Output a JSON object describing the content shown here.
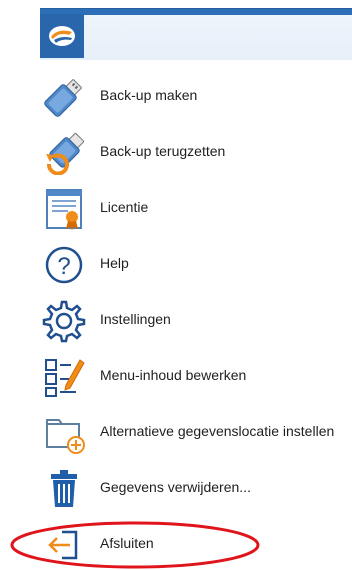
{
  "app": {
    "title_button": "app-logo"
  },
  "menu": {
    "items": [
      {
        "label": "Back-up maken",
        "icon": "usb-drive-icon"
      },
      {
        "label": "Back-up terugzetten",
        "icon": "usb-restore-icon"
      },
      {
        "label": "Licentie",
        "icon": "certificate-icon"
      },
      {
        "label": "Help",
        "icon": "help-icon"
      },
      {
        "label": "Instellingen",
        "icon": "gear-icon"
      },
      {
        "label": "Menu-inhoud bewerken",
        "icon": "edit-list-icon"
      },
      {
        "label": "Alternatieve gegevenslocatie instellen",
        "icon": "folder-add-icon"
      },
      {
        "label": "Gegevens verwijderen...",
        "icon": "trash-icon"
      },
      {
        "label": "Afsluiten",
        "icon": "exit-icon"
      }
    ]
  },
  "colors": {
    "ribbon_blue": "#2a66ac",
    "icon_blue": "#1f5ea8",
    "accent_orange": "#f08c1a",
    "annotation_red": "#e0151b"
  }
}
